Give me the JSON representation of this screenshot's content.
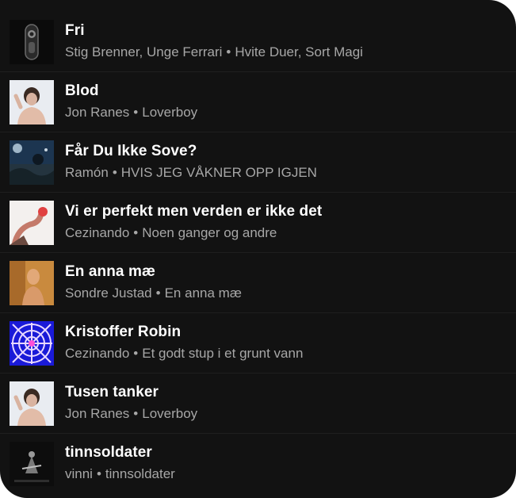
{
  "tracks": [
    {
      "title": "Fri",
      "artist": "Stig Brenner, Unge Ferrari",
      "album": "Hvite Duer, Sort Magi",
      "art_icon": "dark-mask-cover-icon"
    },
    {
      "title": "Blod",
      "artist": "Jon Ranes",
      "album": "Loverboy",
      "art_icon": "shirtless-man-cover-icon"
    },
    {
      "title": "Får Du Ikke Sove?",
      "artist": "Ramón",
      "album": "HVIS JEG VÅKNER OPP IGJEN",
      "art_icon": "night-sky-cover-icon"
    },
    {
      "title": "Vi er perfekt men verden er ikke det",
      "artist": "Cezinando",
      "album": "Noen ganger og andre",
      "art_icon": "red-gesture-cover-icon"
    },
    {
      "title": "En anna mæ",
      "artist": "Sondre Justad",
      "album": "En anna mæ",
      "art_icon": "orange-portrait-cover-icon"
    },
    {
      "title": "Kristoffer Robin",
      "artist": "Cezinando",
      "album": "Et godt stup i et grunt vann",
      "art_icon": "spiderweb-cover-icon"
    },
    {
      "title": "Tusen tanker",
      "artist": "Jon Ranes",
      "album": "Loverboy",
      "art_icon": "shirtless-man-cover-icon"
    },
    {
      "title": "tinnsoldater",
      "artist": "vinni",
      "album": "tinnsoldater",
      "art_icon": "toy-soldier-cover-icon"
    }
  ],
  "separator": "•",
  "colors": {
    "background": "#121212",
    "title": "#ffffff",
    "subtitle": "#a7a7a7"
  }
}
